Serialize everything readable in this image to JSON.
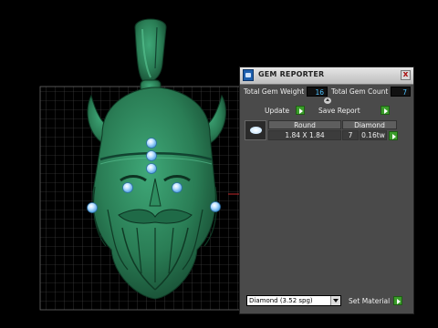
{
  "panel": {
    "title": "GEM REPORTER",
    "close_label": "x",
    "total_gem_weight_label": "Total Gem Weight",
    "total_gem_weight_value": "16",
    "total_gem_count_label": "Total Gem Count",
    "total_gem_count_value": "7",
    "update_label": "Update",
    "save_report_label": "Save Report",
    "table": {
      "headers": [
        "Round",
        "Diamond"
      ],
      "row": {
        "size": "1.84 X 1.84",
        "count": "7",
        "weight": "0.16tw"
      }
    },
    "material_select_value": "Diamond    (3.52 spg)",
    "set_material_label": "Set Material"
  },
  "viewport": {
    "model": "viking-head-pendant",
    "model_color": "#2e8a5c",
    "gem_color": "#9fd3ff",
    "grid_color": "#5a5a5a"
  }
}
